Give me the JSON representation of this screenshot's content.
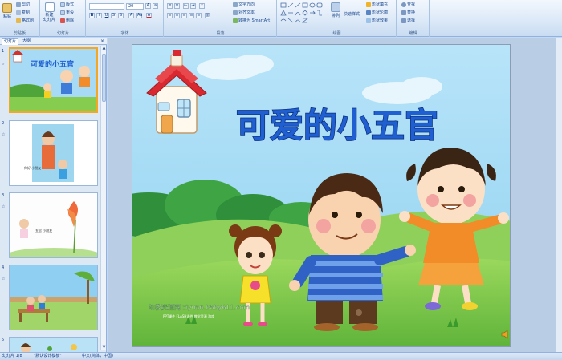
{
  "ribbon": {
    "clipboard": {
      "paste": "粘贴",
      "cut": "剪切",
      "copy": "复制",
      "format_painter": "格式刷",
      "group": "剪贴板"
    },
    "slides": {
      "new_slide": "新建\n幻灯片",
      "layout": "版式",
      "reset": "重设",
      "delete": "删除",
      "group": "幻灯片"
    },
    "font": {
      "font_size": "20",
      "group": "字体"
    },
    "paragraph": {
      "text_direction": "文字方向",
      "align_text": "对齐文本",
      "smartart": "转换为 SmartArt",
      "group": "段落"
    },
    "drawing": {
      "arrange": "排列",
      "quick_styles": "快速样式",
      "shape_fill": "形状填充",
      "shape_outline": "形状轮廓",
      "shape_effects": "形状效果",
      "group": "绘图"
    },
    "editing": {
      "find": "查找",
      "replace": "替换",
      "select": "选择",
      "group": "编辑"
    }
  },
  "panel": {
    "tab_slides": "幻灯片",
    "tab_outline": "大纲",
    "close": "×"
  },
  "thumbnails": [
    {
      "number": "1",
      "title": "可爱的小五官"
    },
    {
      "number": "2",
      "caption": "你好 小朋友"
    },
    {
      "number": "3",
      "caption": "五官 小朋友"
    },
    {
      "number": "4"
    },
    {
      "number": "5"
    }
  ],
  "slide": {
    "title": "可爱的小五官",
    "watermark_main": "幼教资源网 ziyuan.baby611.com",
    "watermark_sub": "PPT课件 FLASH课件 教学资源 游戏"
  },
  "status": {
    "slide_counter": "幻灯片 1/8",
    "theme": "\"默认设计模板\"",
    "language": "中文(简体，中国)"
  },
  "colors": {
    "ribbon_bg": "#dbe8f7",
    "slide_title": "#1f5fd1",
    "sky": "#9fd6f4",
    "grass": "#7cc84a"
  }
}
